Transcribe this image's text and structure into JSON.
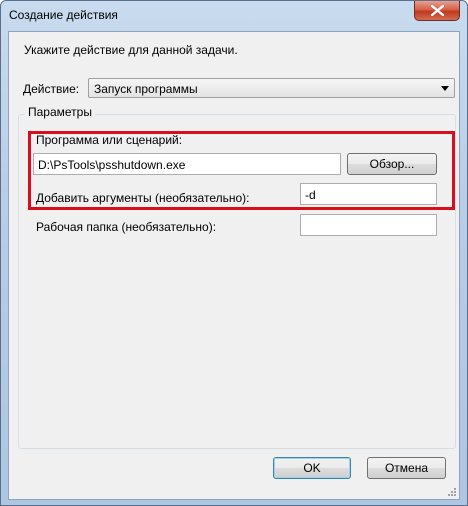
{
  "window": {
    "title": "Создание действия"
  },
  "dialog": {
    "instruction": "Укажите действие для данной задачи.",
    "action_label": "Действие:",
    "action_value": "Запуск программы",
    "group_title": "Параметры",
    "program_label": "Программа или сценарий:",
    "program_value": "D:\\PsTools\\psshutdown.exe",
    "browse_label": "Обзор...",
    "args_label": "Добавить аргументы (необязательно):",
    "args_value": "-d",
    "workdir_label": "Рабочая папка (необязательно):",
    "workdir_value": "",
    "ok_label": "OK",
    "cancel_label": "Отмена"
  },
  "colors": {
    "highlight": "#d80f1b",
    "close_button": "#c0391f"
  },
  "icons": {
    "close": "close-icon",
    "dropdown": "chevron-down-icon",
    "grip": "resize-grip-icon"
  }
}
